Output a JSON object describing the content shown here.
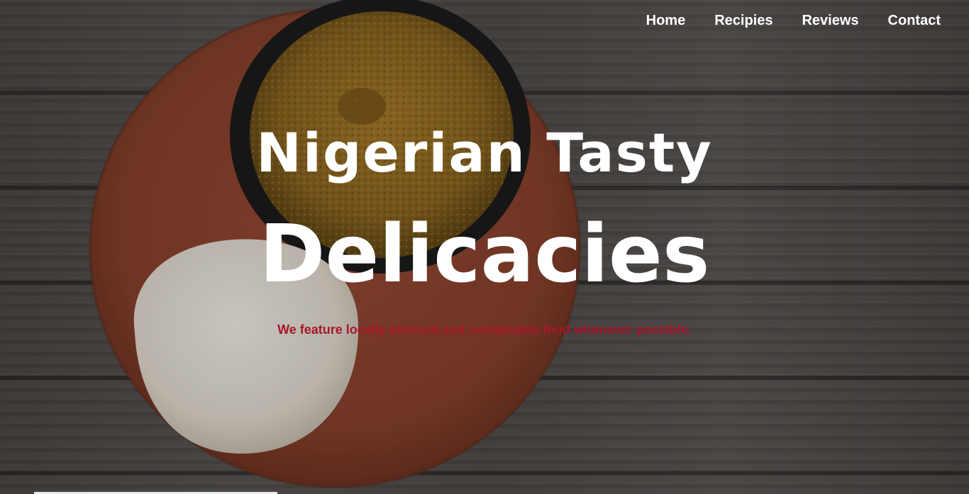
{
  "nav": {
    "items": [
      {
        "label": "Home"
      },
      {
        "label": "Recipies"
      },
      {
        "label": "Reviews"
      },
      {
        "label": "Contact"
      }
    ]
  },
  "hero": {
    "title_line1": "Nigerian Tasty",
    "title_line2": "Delicacies",
    "tagline": "We feature locally sourced and sustainable food whenever possible."
  },
  "colors": {
    "title": "#ffffff",
    "tagline": "#a8162a",
    "nav_link": "#ffffff",
    "plate": "#8a3f2b",
    "bowl": "#1e1e1e",
    "soup": "#8f6a22",
    "fufu": "#e9e4dc"
  }
}
